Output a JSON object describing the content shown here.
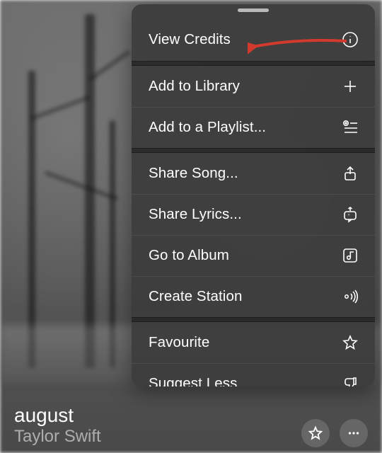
{
  "menu": {
    "view_credits": "View Credits",
    "add_library": "Add to Library",
    "add_playlist": "Add to a Playlist...",
    "share_song": "Share Song...",
    "share_lyrics": "Share Lyrics...",
    "go_album": "Go to Album",
    "create_station": "Create Station",
    "favourite": "Favourite",
    "suggest_less": "Suggest Less"
  },
  "track": {
    "title": "august",
    "artist": "Taylor Swift"
  },
  "colors": {
    "arrow": "#d23a2e"
  }
}
